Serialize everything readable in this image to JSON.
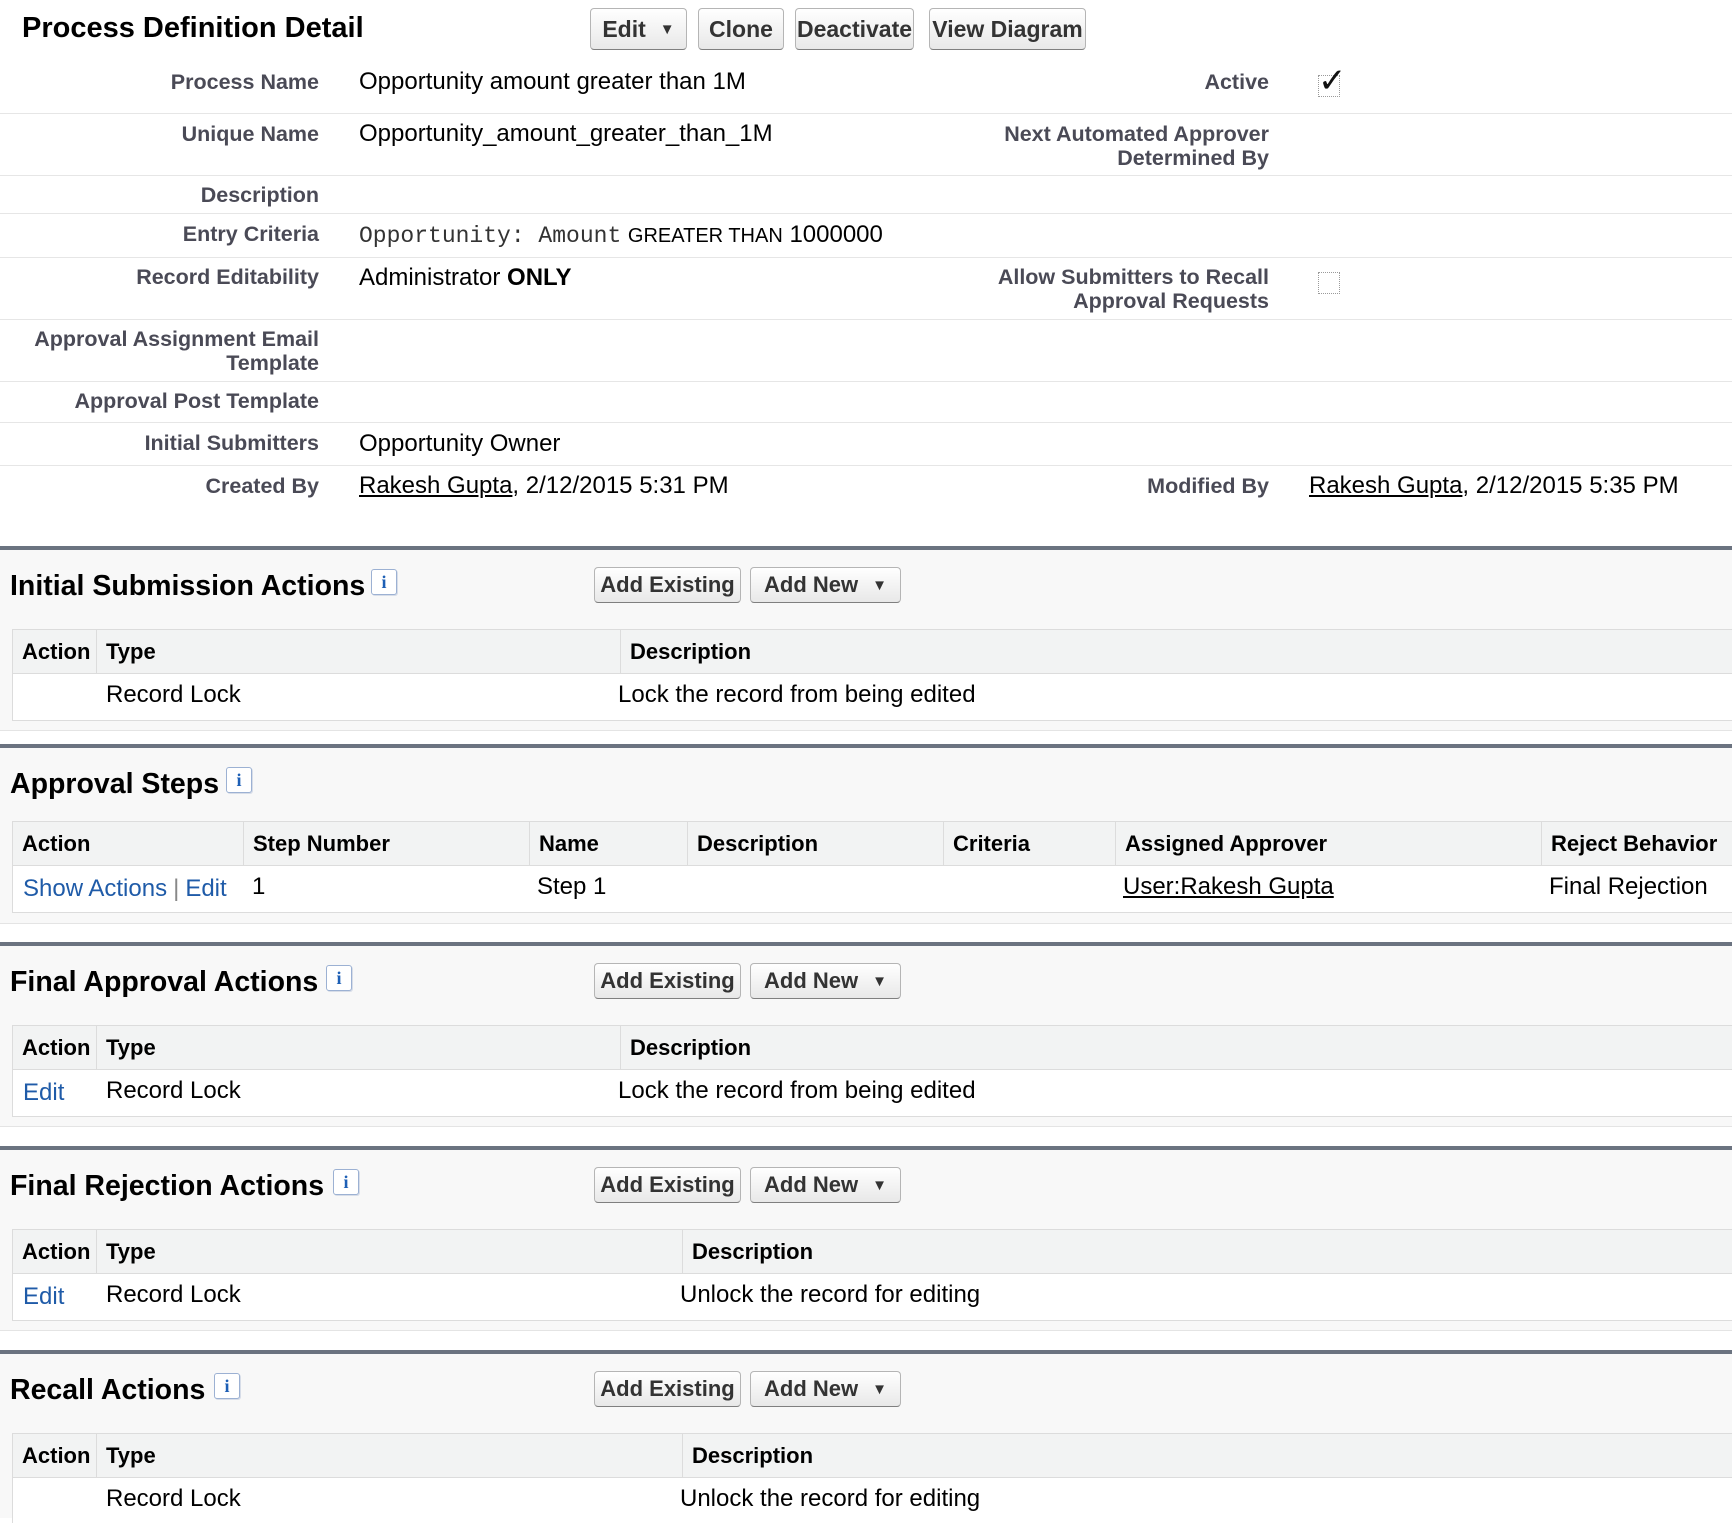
{
  "header": {
    "title": "Process Definition Detail",
    "buttons": {
      "edit": "Edit",
      "clone": "Clone",
      "deactivate": "Deactivate",
      "view_diagram": "View Diagram"
    }
  },
  "detail": {
    "process_name": {
      "label": "Process Name",
      "value": "Opportunity amount greater than 1M"
    },
    "active": {
      "label": "Active",
      "checked": true
    },
    "unique_name": {
      "label": "Unique Name",
      "value": "Opportunity_amount_greater_than_1M"
    },
    "next_approver": {
      "label_line1": "Next Automated Approver",
      "label_line2": "Determined By",
      "value": ""
    },
    "description": {
      "label": "Description",
      "value": ""
    },
    "entry_criteria": {
      "label": "Entry Criteria",
      "field": "Opportunity: Amount",
      "operator": "GREATER THAN",
      "value": "1000000"
    },
    "record_editability": {
      "label": "Record Editability",
      "value_prefix": "Administrator",
      "value_bold": "ONLY"
    },
    "allow_recall": {
      "label_line1": "Allow Submitters to Recall",
      "label_line2": "Approval Requests",
      "checked": false
    },
    "assignment_email": {
      "label_line1": "Approval Assignment Email",
      "label_line2": "Template",
      "value": ""
    },
    "post_template": {
      "label": "Approval Post Template",
      "value": ""
    },
    "initial_submitters": {
      "label": "Initial Submitters",
      "value": "Opportunity Owner"
    },
    "created_by": {
      "label": "Created By",
      "user": "Rakesh Gupta",
      "date": ", 2/12/2015 5:31 PM"
    },
    "modified_by": {
      "label": "Modified By",
      "user": "Rakesh Gupta",
      "date": ", 2/12/2015 5:35 PM"
    }
  },
  "sections": {
    "initial_submission": {
      "title": "Initial Submission Actions",
      "add_existing": "Add Existing",
      "add_new": "Add New",
      "columns": [
        "Action",
        "Type",
        "Description"
      ],
      "rows": [
        {
          "action": "",
          "type": "Record Lock",
          "description": "Lock the record from being edited"
        }
      ]
    },
    "approval_steps": {
      "title": "Approval Steps",
      "columns": [
        "Action",
        "Step Number",
        "Name",
        "Description",
        "Criteria",
        "Assigned Approver",
        "Reject Behavior"
      ],
      "rows": [
        {
          "show_actions": "Show Actions",
          "sep": "|",
          "edit": "Edit",
          "step_number": "1",
          "name": "Step 1",
          "description": "",
          "criteria": "",
          "approver": "User:Rakesh Gupta",
          "reject": "Final Rejection"
        }
      ]
    },
    "final_approval": {
      "title": "Final Approval Actions",
      "add_existing": "Add Existing",
      "add_new": "Add New",
      "columns": [
        "Action",
        "Type",
        "Description"
      ],
      "rows": [
        {
          "action": "Edit",
          "type": "Record Lock",
          "description": "Lock the record from being edited"
        }
      ]
    },
    "final_rejection": {
      "title": "Final Rejection Actions",
      "add_existing": "Add Existing",
      "add_new": "Add New",
      "columns": [
        "Action",
        "Type",
        "Description"
      ],
      "rows": [
        {
          "action": "Edit",
          "type": "Record Lock",
          "description": "Unlock the record for editing"
        }
      ]
    },
    "recall": {
      "title": "Recall Actions",
      "add_existing": "Add Existing",
      "add_new": "Add New",
      "columns": [
        "Action",
        "Type",
        "Description"
      ],
      "rows": [
        {
          "action": "",
          "type": "Record Lock",
          "description": "Unlock the record for editing"
        }
      ]
    }
  },
  "icons": {
    "info": "info-icon",
    "caret": "caret-down-icon",
    "check": "checkmark-icon"
  },
  "colors": {
    "section_border": "#6b7380",
    "link_blue": "#1f5ba8",
    "label_gray": "#4a4a56"
  }
}
